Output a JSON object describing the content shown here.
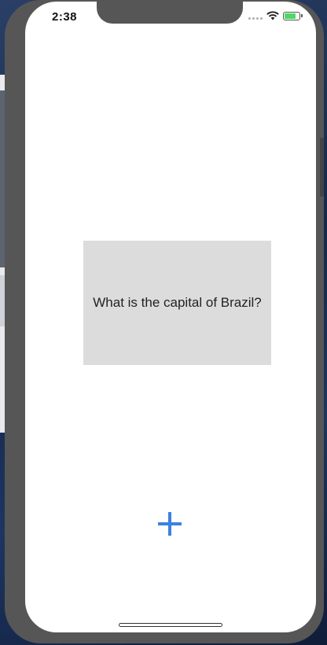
{
  "status_bar": {
    "time": "2:38",
    "battery_level": 0.8,
    "battery_color": "#4cd964",
    "icons": [
      "signal-icon",
      "wifi-icon",
      "battery-icon"
    ]
  },
  "card": {
    "question": "What is the capital of Brazil?",
    "background": "#dcdcdc"
  },
  "add_button": {
    "icon": "plus-icon",
    "color": "#3a82e0"
  }
}
